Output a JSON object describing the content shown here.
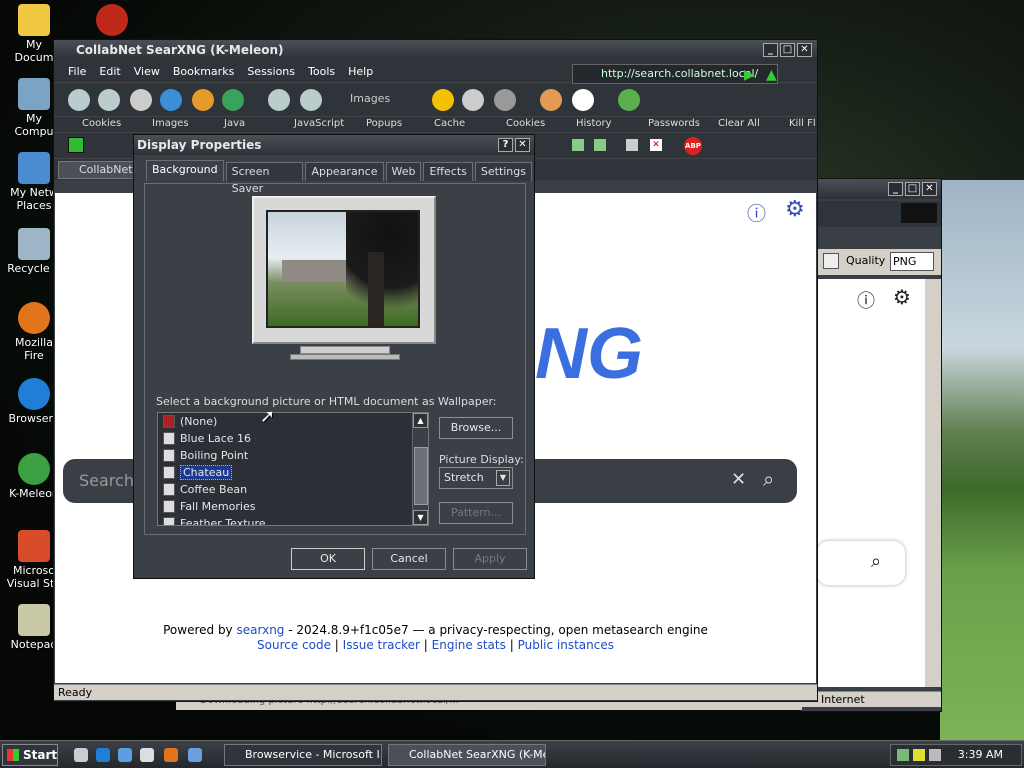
{
  "desktop_icons": [
    {
      "label": "My Docum",
      "name": "my-documents",
      "color": "#f1c940"
    },
    {
      "label": "",
      "name": "red-app",
      "color": "#c0281a"
    },
    {
      "label": "My Compu",
      "name": "my-computer",
      "color": "#7aa3c4"
    },
    {
      "label": "My Netw Places",
      "name": "my-network-places",
      "color": "#4a8bd1"
    },
    {
      "label": "Recycle B",
      "name": "recycle-bin",
      "color": "#9fb6c9"
    },
    {
      "label": "Mozilla Fire",
      "name": "mozilla-firefox",
      "color": "#e2741b"
    },
    {
      "label": "Browserv",
      "name": "browservice",
      "color": "#1f7fd6"
    },
    {
      "label": "K-Meleon",
      "name": "k-meleon",
      "color": "#3aa041"
    },
    {
      "label": "Microso Visual Stu",
      "name": "visual-studio",
      "color": "#d94c2a"
    },
    {
      "label": "Notepad",
      "name": "notepad",
      "color": "#c9c9a8"
    }
  ],
  "browser": {
    "title": "CollabNet SearXNG (K-Meleon)",
    "menu": [
      "File",
      "Edit",
      "View",
      "Bookmarks",
      "Sessions",
      "Tools",
      "Help"
    ],
    "url": "http://search.collabnet.local/",
    "images_button": "Images",
    "bookmarks": [
      "Cookies",
      "Images",
      "Java",
      "JavaScript",
      "Popups",
      "Cache",
      "Cookies",
      "History",
      "Passwords",
      "Clear All",
      "Kill Fl"
    ],
    "tab_label": "CollabNet S",
    "status": "Ready",
    "logo_fragment": "NG",
    "search_placeholder": "Search",
    "powered_by": "Powered by",
    "searxng_link": "searxng",
    "version_text": "- 2024.8.9+f1c05e7 — a privacy-respecting, open metasearch engine",
    "links": [
      "Source code",
      "Issue tracker",
      "Engine stats",
      "Public instances"
    ]
  },
  "back_window": {
    "quality_label": "Quality",
    "quality_value": "PNG",
    "status_zone": "Internet",
    "status_text": "Downloading picture http://search.collabnet.local/..."
  },
  "dialog": {
    "title": "Display Properties",
    "tabs": [
      "Background",
      "Screen Saver",
      "Appearance",
      "Web",
      "Effects",
      "Settings"
    ],
    "active_tab": "Background",
    "instruction": "Select a background picture or HTML document as Wallpaper:",
    "wallpapers": [
      "(None)",
      "Blue Lace 16",
      "Boiling Point",
      "Chateau",
      "Coffee Bean",
      "Fall Memories",
      "Feather Texture"
    ],
    "selected": "Chateau",
    "browse": "Browse...",
    "picture_display_label": "Picture Display:",
    "picture_display_value": "Stretch",
    "pattern": "Pattern...",
    "ok": "OK",
    "cancel": "Cancel",
    "apply": "Apply"
  },
  "taskbar": {
    "start": "Start",
    "tasks": [
      "Browservice - Microsoft I...",
      "CollabNet SearXNG (K-Mel..."
    ],
    "clock": "3:39 AM"
  }
}
